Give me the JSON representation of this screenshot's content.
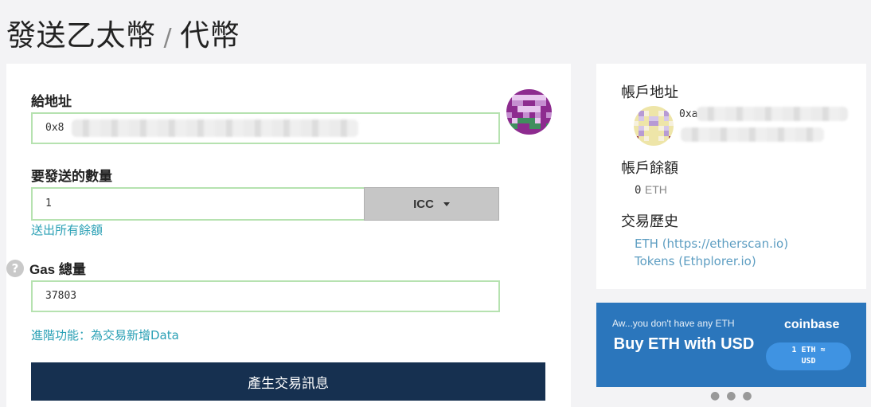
{
  "page": {
    "title_part1": "發送乙太幣",
    "title_separator": "/",
    "title_part2": "代幣"
  },
  "form": {
    "to_label": "給地址",
    "to_value": "0x8",
    "amount_label": "要發送的數量",
    "amount_value": "1",
    "token_selected": "ICC",
    "send_all_link": "送出所有餘額",
    "gas_label": "Gas 總量",
    "gas_value": "37803",
    "advanced_link": "進階功能：為交易新增Data",
    "generate_button": "產生交易訊息",
    "help_icon_glyph": "?"
  },
  "sidebar": {
    "account_address_label": "帳戶地址",
    "account_address_prefix": "0xa",
    "balance_label": "帳戶餘額",
    "balance_value": "0",
    "balance_unit": "ETH",
    "history_label": "交易歷史",
    "history_links": [
      "ETH (https://etherscan.io)",
      "Tokens (Ethplorer.io)"
    ]
  },
  "ad": {
    "tagline": "Aw...you don't have any ETH",
    "headline": "Buy ETH with USD",
    "brand": "coinbase",
    "pill_line1": "1 ETH ≈",
    "pill_line2": "USD"
  },
  "colors": {
    "accent_link": "#2aa0b5",
    "primary_button": "#163050",
    "ad_background": "#2b76bc",
    "input_border": "#b6e2b0"
  }
}
